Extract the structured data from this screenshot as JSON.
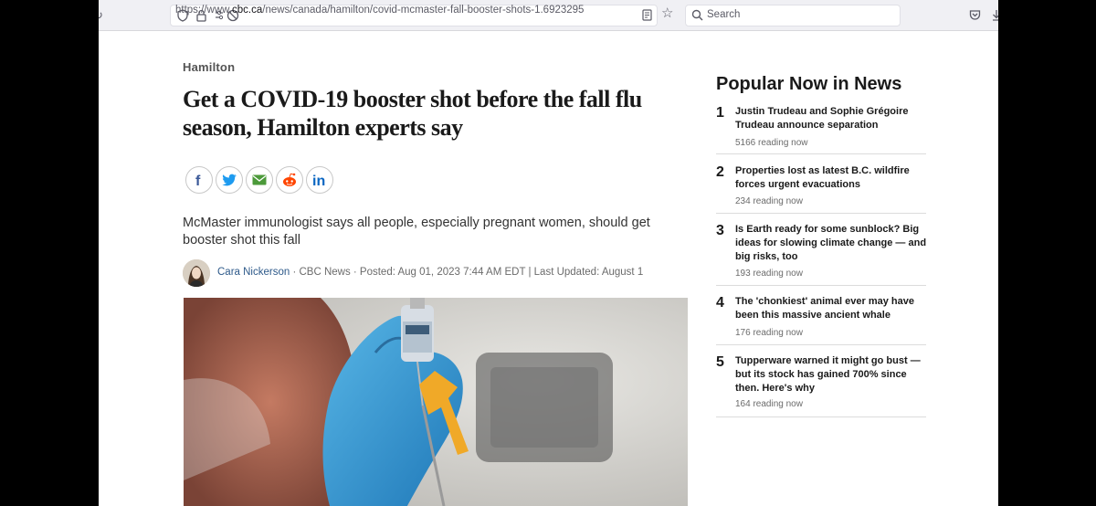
{
  "browser": {
    "url_scheme": "https://www.",
    "url_host": "cbc.ca",
    "url_path": "/news/canada/hamilton/covid-mcmaster-fall-booster-shots-1.6923295",
    "search_placeholder": "Search"
  },
  "article": {
    "category": "Hamilton",
    "headline": "Get a COVID-19 booster shot before the fall flu season, Hamilton experts say",
    "deck": "McMaster immunologist says all people, especially pregnant women, should get booster shot this fall",
    "author": "Cara Nickerson",
    "byline_rest": " · CBC News · Posted: Aug 01, 2023 7:44 AM EDT | Last Updated: August 1"
  },
  "share_icons": [
    "facebook-icon",
    "twitter-icon",
    "email-icon",
    "reddit-icon",
    "linkedin-icon"
  ],
  "popular": {
    "title": "Popular Now in News",
    "items": [
      {
        "num": "1",
        "title": "Justin Trudeau and Sophie Grégoire Trudeau announce separation",
        "meta": "5166 reading now"
      },
      {
        "num": "2",
        "title": "Properties lost as latest B.C. wildfire forces urgent evacuations",
        "meta": "234 reading now"
      },
      {
        "num": "3",
        "title": "Is Earth ready for some sunblock? Big ideas for slowing climate change — and big risks, too",
        "meta": "193 reading now"
      },
      {
        "num": "4",
        "title": "The 'chonkiest' animal ever may have been this massive ancient whale",
        "meta": "176 reading now"
      },
      {
        "num": "5",
        "title": "Tupperware warned it might go bust — but its stock has gained 700% since then. Here's why",
        "meta": "164 reading now"
      }
    ]
  },
  "colors": {
    "facebook": "#3b5998",
    "twitter": "#1d9bf0",
    "email": "#4c9a3a",
    "reddit": "#ff4500",
    "linkedin": "#0a66c2"
  }
}
